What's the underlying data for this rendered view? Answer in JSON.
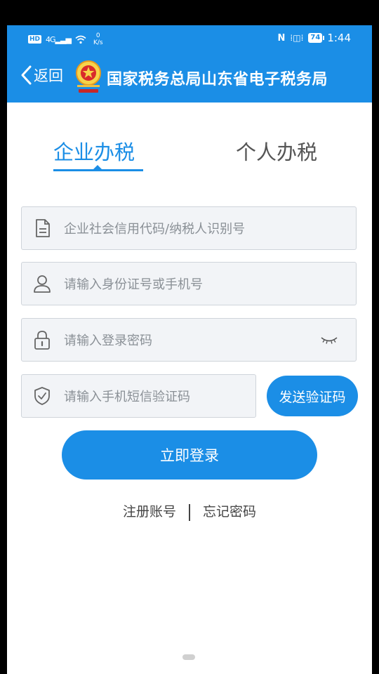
{
  "status_bar": {
    "hd": "HD",
    "network": "4G",
    "speed_value": "0",
    "speed_unit": "K/s",
    "nfc": "N",
    "vibrate": "⁞◫⁞",
    "battery": "74",
    "time": "1:44"
  },
  "header": {
    "back_label": "返回",
    "title": "国家税务总局山东省电子税务局"
  },
  "tabs": [
    {
      "label": "企业办税",
      "active": true
    },
    {
      "label": "个人办税",
      "active": false
    }
  ],
  "form": {
    "credit_code_placeholder": "企业社会信用代码/纳税人识别号",
    "id_phone_placeholder": "请输入身份证号或手机号",
    "password_placeholder": "请输入登录密码",
    "sms_code_placeholder": "请输入手机短信验证码",
    "send_code_label": "发送验证码",
    "login_label": "立即登录"
  },
  "links": {
    "register": "注册账号",
    "forgot_password": "忘记密码"
  },
  "colors": {
    "accent": "#1b8ee6",
    "field_bg": "#f2f4f7",
    "field_border": "#cfd4da"
  },
  "icons": {
    "back": "chevron-left-icon",
    "emblem": "tax-emblem-icon",
    "credit_code": "document-icon",
    "user": "user-icon",
    "password": "lock-icon",
    "sms_code": "shield-check-icon",
    "toggle_password": "eye-closed-icon"
  }
}
